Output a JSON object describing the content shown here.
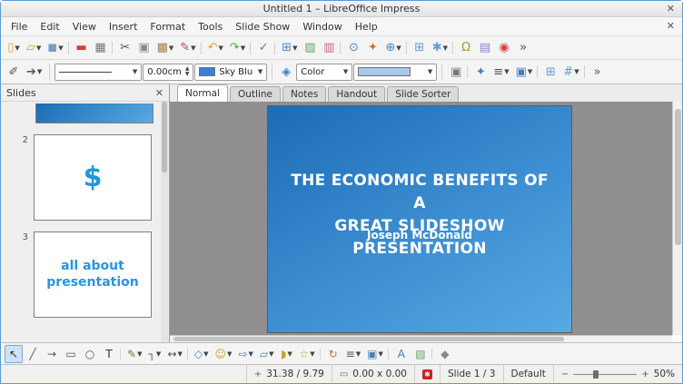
{
  "colors": {
    "accent_blue": "#2596e0",
    "slide_gradient_start": "#1b6cb5",
    "slide_gradient_end": "#57a9e3"
  },
  "window": {
    "title": "Untitled 1 – LibreOffice Impress",
    "close_glyph": "✕"
  },
  "menubar": {
    "items": [
      "File",
      "Edit",
      "View",
      "Insert",
      "Format",
      "Tools",
      "Slide Show",
      "Window",
      "Help"
    ],
    "close_glyph": "✕"
  },
  "toolbar_standard": {
    "icons": [
      {
        "name": "new-presentation-button",
        "glyph": "▯",
        "color": "#d9a33c",
        "dd": true
      },
      {
        "name": "open-file-button",
        "glyph": "▱",
        "color": "#c9a227",
        "dd": true
      },
      {
        "name": "save-button",
        "glyph": "◼",
        "color": "#7a99c4",
        "dd": true,
        "sep": true
      },
      {
        "name": "export-pdf-button",
        "glyph": "▬",
        "color": "#cc4040"
      },
      {
        "name": "print-button",
        "glyph": "▦",
        "color": "#777777",
        "sep": true
      },
      {
        "name": "cut-button",
        "glyph": "✂",
        "color": "#555555"
      },
      {
        "name": "copy-button",
        "glyph": "▣",
        "color": "#888888"
      },
      {
        "name": "paste-button",
        "glyph": "▩",
        "color": "#a8824f",
        "dd": true
      },
      {
        "name": "clone-formatting-button",
        "glyph": "✎",
        "color": "#b05050",
        "dd": true,
        "sep": true
      },
      {
        "name": "undo-button",
        "glyph": "↶",
        "color": "#e0a437",
        "dd": true
      },
      {
        "name": "redo-button",
        "glyph": "↷",
        "color": "#58a858",
        "dd": true,
        "sep": true
      },
      {
        "name": "spelling-button",
        "glyph": "✓",
        "color": "#3f9b3f",
        "sep": true
      },
      {
        "name": "insert-table-button",
        "glyph": "⊞",
        "color": "#5588cc",
        "dd": true
      },
      {
        "name": "insert-image-button",
        "glyph": "▨",
        "color": "#66a366"
      },
      {
        "name": "insert-chart-button",
        "glyph": "▥",
        "color": "#cc6688",
        "sep": true
      },
      {
        "name": "find-replace-button",
        "glyph": "⊙",
        "color": "#4488cc"
      },
      {
        "name": "navigator-button",
        "glyph": "✦",
        "color": "#cc7733"
      },
      {
        "name": "zoom-button",
        "glyph": "⊕",
        "color": "#4488cc",
        "dd": true,
        "sep": true
      },
      {
        "name": "display-grid-button",
        "glyph": "⊞",
        "color": "#6699dd"
      },
      {
        "name": "snap-guides-button",
        "glyph": "✱",
        "color": "#6699dd",
        "dd": true,
        "sep": true
      },
      {
        "name": "special-character-button",
        "glyph": "Ω",
        "color": "#b8912a"
      },
      {
        "name": "gallery-button",
        "glyph": "▤",
        "color": "#9977cc"
      },
      {
        "name": "help-button",
        "glyph": "◉",
        "color": "#d44444"
      },
      {
        "name": "toolbar-overflow-button",
        "glyph": "»",
        "color": "#555555"
      }
    ]
  },
  "toolbar_line": {
    "edit_points_glyph": "✐",
    "arrow_style_glyph": "➔",
    "line_width_value": "0.00cm",
    "line_color_label": "Sky Blu",
    "line_color_swatch": "#3b7fd4",
    "fill_icon_glyph": "◈",
    "area_style_label": "Color",
    "area_fill_swatch": "#a9c9e8",
    "trailing_icons": [
      {
        "name": "shadow-button",
        "glyph": "▣",
        "color": "#777777",
        "sep": true
      },
      {
        "name": "interaction-button",
        "glyph": "✦",
        "color": "#4a7fb5"
      },
      {
        "name": "align-objects-button",
        "glyph": "≡",
        "color": "#555555",
        "dd": true
      },
      {
        "name": "arrange-button",
        "glyph": "▣",
        "color": "#4a7fb5",
        "dd": true,
        "sep": true
      },
      {
        "name": "display-grid-button",
        "glyph": "⊞",
        "color": "#6699dd"
      },
      {
        "name": "helplines-button",
        "glyph": "#",
        "color": "#6699dd",
        "dd": true,
        "sep": true
      },
      {
        "name": "toolbar-overflow-button",
        "glyph": "»",
        "color": "#555555"
      }
    ]
  },
  "slides_panel": {
    "title": "Slides",
    "close_glyph": "✕",
    "slides": [
      {
        "number": "2",
        "symbol": "$"
      },
      {
        "number": "3",
        "line1": "all about",
        "line2": "presentation"
      }
    ]
  },
  "view_tabs": {
    "tabs": [
      {
        "label": "Normal",
        "active": true
      },
      {
        "label": "Outline"
      },
      {
        "label": "Notes"
      },
      {
        "label": "Handout"
      },
      {
        "label": "Slide Sorter"
      }
    ]
  },
  "slide": {
    "title_line1": "THE ECONOMIC BENEFITS OF A",
    "title_line2": "GREAT SLIDESHOW PRESENTATION",
    "subtitle": "Joseph McDonald"
  },
  "toolbar_drawing": {
    "icons": [
      {
        "name": "select-tool",
        "glyph": "↖",
        "color": "#333333",
        "sel": true
      },
      {
        "name": "line-tool",
        "glyph": "╱",
        "color": "#555555"
      },
      {
        "name": "arrow-line-tool",
        "glyph": "→",
        "color": "#555555"
      },
      {
        "name": "rectangle-tool",
        "glyph": "▭",
        "color": "#555555"
      },
      {
        "name": "ellipse-tool",
        "glyph": "○",
        "color": "#555555"
      },
      {
        "name": "text-box-tool",
        "glyph": "T",
        "color": "#333333",
        "sep": true
      },
      {
        "name": "curve-tool",
        "glyph": "✎",
        "color": "#8a6d3b",
        "dd": true
      },
      {
        "name": "connector-tool",
        "glyph": "┐",
        "color": "#555555",
        "dd": true
      },
      {
        "name": "lines-arrows-tool",
        "glyph": "↔",
        "color": "#555555",
        "dd": true,
        "sep": true
      },
      {
        "name": "basic-shapes-tool",
        "glyph": "◇",
        "color": "#4a7fb5",
        "dd": true
      },
      {
        "name": "symbol-shapes-tool",
        "glyph": "☺",
        "color": "#c9a227",
        "dd": true
      },
      {
        "name": "block-arrows-tool",
        "glyph": "⇨",
        "color": "#4a7fb5",
        "dd": true
      },
      {
        "name": "flowchart-tool",
        "glyph": "▱",
        "color": "#4a7fb5",
        "dd": true
      },
      {
        "name": "callouts-tool",
        "glyph": "◗",
        "color": "#c9a227",
        "dd": true
      },
      {
        "name": "stars-tool",
        "glyph": "☆",
        "color": "#c9a227",
        "dd": true,
        "sep": true
      },
      {
        "name": "rotate-tool",
        "glyph": "↻",
        "color": "#c87137"
      },
      {
        "name": "align-objects-button",
        "glyph": "≡",
        "color": "#555555",
        "dd": true
      },
      {
        "name": "arrange-button",
        "glyph": "▣",
        "color": "#4a7fb5",
        "dd": true,
        "sep": true
      },
      {
        "name": "fontwork-button",
        "glyph": "A",
        "color": "#3a7fd0"
      },
      {
        "name": "insert-image-button",
        "glyph": "▨",
        "color": "#66a366",
        "sep": true
      },
      {
        "name": "toggle-extrusion-button",
        "glyph": "◆",
        "color": "#888888"
      }
    ]
  },
  "statusbar": {
    "position": "31.38 / 9.79",
    "position_icon": "+",
    "size": "0.00 x 0.00",
    "size_icon": "▭",
    "modified_glyph": "✱",
    "page": "Slide 1 / 3",
    "style": "Default",
    "zoom_minus": "−",
    "zoom_plus": "+",
    "zoom": "50%"
  }
}
